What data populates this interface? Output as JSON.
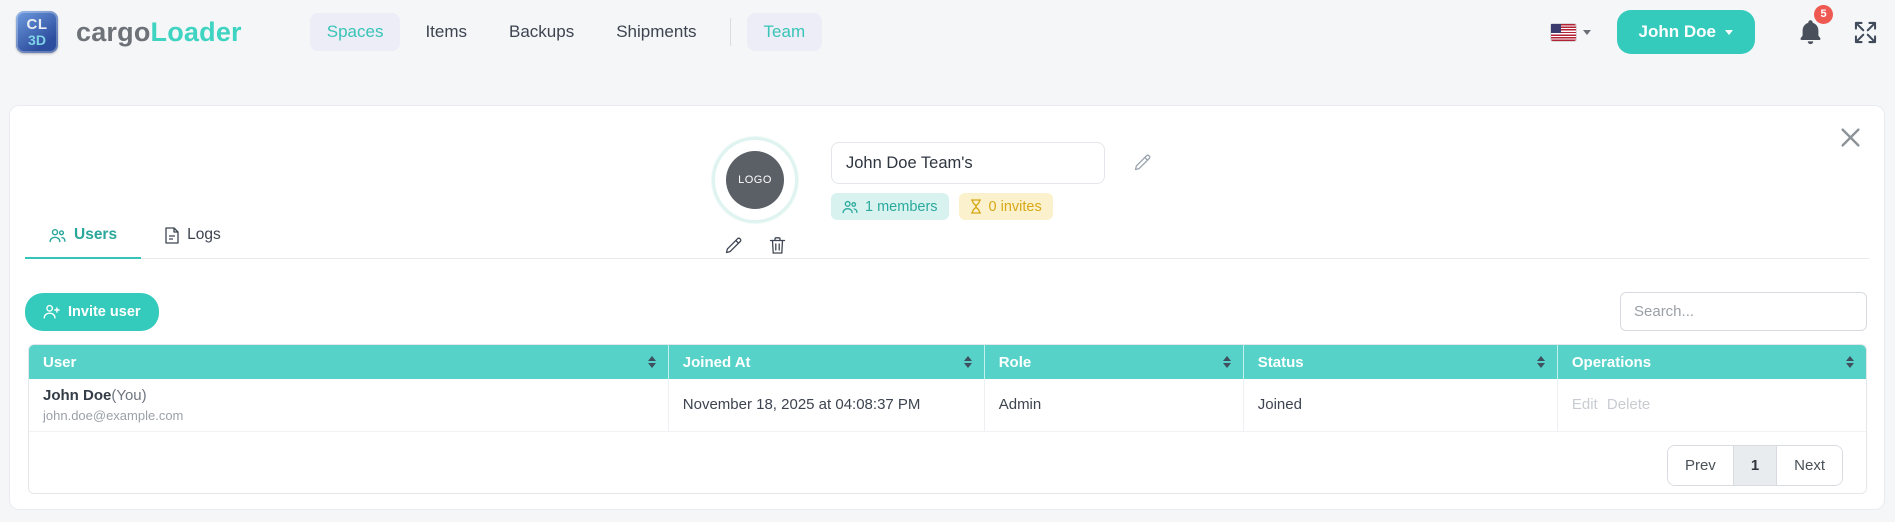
{
  "brand": {
    "logo_line1": "CL",
    "logo_line2": "3D",
    "name_gray": "cargo",
    "name_teal": "Loader"
  },
  "nav": {
    "items": [
      {
        "label": "Spaces",
        "active": true
      },
      {
        "label": "Items",
        "active": false
      },
      {
        "label": "Backups",
        "active": false
      },
      {
        "label": "Shipments",
        "active": false
      },
      {
        "label": "Team",
        "active": true
      }
    ]
  },
  "header_right": {
    "language_flag": "us-flag",
    "user_button": "John Doe",
    "notification_count": "5"
  },
  "team": {
    "avatar_text": "LOGO",
    "name_value": "John Doe Team's",
    "members_badge": "1 members",
    "invites_badge": "0 invites"
  },
  "tabs": {
    "users": "Users",
    "logs": "Logs"
  },
  "toolbar": {
    "invite_button": "Invite user",
    "search_placeholder": "Search..."
  },
  "table": {
    "columns": [
      "User",
      "Joined At",
      "Role",
      "Status",
      "Operations"
    ],
    "rows": [
      {
        "name": "John Doe",
        "name_suffix": "(You)",
        "email": "john.doe@example.com",
        "joined_at": "November 18, 2025 at 04:08:37 PM",
        "role": "Admin",
        "status": "Joined",
        "operations": [
          "Edit",
          "Delete"
        ]
      }
    ]
  },
  "pagination": {
    "prev": "Prev",
    "page": "1",
    "next": "Next"
  },
  "icons": {
    "members_badge": "people-icon",
    "invites_badge": "hourglass-icon",
    "users_tab": "people-icon",
    "logs_tab": "file-icon",
    "avatar_actions": [
      "pencil-icon",
      "trash-icon"
    ],
    "name_edit": "pencil-icon",
    "invite_button": "person-plus-icon",
    "header_icons": [
      "us-flag-icon",
      "bell-icon",
      "expand-icon"
    ],
    "close": "close-icon"
  },
  "colors": {
    "accent_teal": "#35cbbc",
    "table_header_teal": "#56d2c8",
    "badge_teal_bg": "#d8f3ef",
    "badge_amber_bg": "#fbf2cd",
    "notification_red": "#ee5a52"
  }
}
